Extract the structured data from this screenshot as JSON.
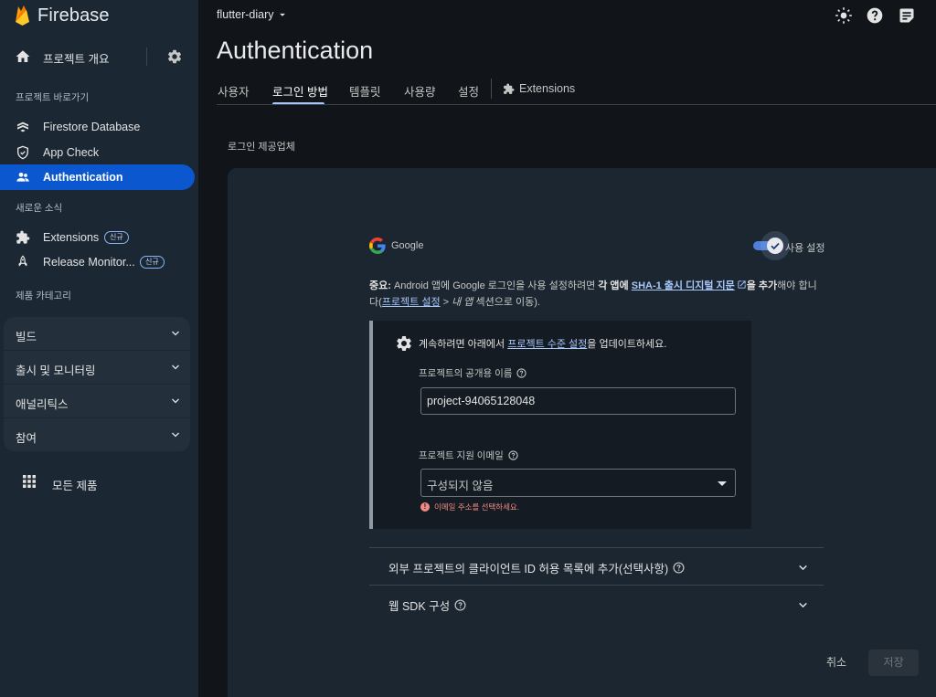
{
  "brand": {
    "name": "Firebase"
  },
  "sidebar": {
    "overview_label": "프로젝트 개요",
    "shortcuts_title": "프로젝트 바로가기",
    "shortcuts": [
      {
        "label": "Firestore Database",
        "icon": "firestore-icon"
      },
      {
        "label": "App Check",
        "icon": "shield-icon"
      },
      {
        "label": "Authentication",
        "icon": "people-icon",
        "active": true
      }
    ],
    "news_title": "새로운 소식",
    "news": [
      {
        "label": "Extensions",
        "badge": "신규",
        "icon": "puzzle-icon"
      },
      {
        "label": "Release Monitor...",
        "badge": "신규",
        "icon": "rocket-icon"
      }
    ],
    "categories_title": "제품 카테고리",
    "categories": [
      "빌드",
      "출시 및 모니터링",
      "애널리틱스",
      "참여"
    ],
    "all_products_label": "모든 제품"
  },
  "header": {
    "project_name": "flutter-diary",
    "title": "Authentication",
    "tabs": [
      "사용자",
      "로그인 방법",
      "템플릿",
      "사용량",
      "설정",
      "Extensions"
    ],
    "active_tab": "로그인 방법"
  },
  "main": {
    "section_label": "로그인 제공업체",
    "provider": {
      "name": "Google",
      "enabled": true,
      "toggle_label": "사용 설정"
    },
    "notice": {
      "important": "중요:",
      "text1": " Android 앱에 Google 로그인을 사용 설정하려면 ",
      "each_app": "각 앱에",
      "sha_link": "SHA-1 출시 디지털 지문",
      "add": "을 추가",
      "text2": "해야 합니다(",
      "settings_link": "프로젝트 설정",
      "text3": " > ",
      "my_apps": "내 앱",
      "text4": " 섹션으로 이동)."
    },
    "panel": {
      "msg_pre": "계속하려면 아래에서 ",
      "msg_link": "프로젝트 수준 설정",
      "msg_post": "을 업데이트하세요.",
      "public_name_label": "프로젝트의 공개용 이름",
      "public_name_value": "project-94065128048",
      "support_email_label": "프로젝트 지원 이메일",
      "support_email_value": "구성되지 않음",
      "error": "이메일 주소를 선택하세요."
    },
    "accordions": [
      "외부 프로젝트의 클라이언트 ID 허용 목록에 추가(선택사항)",
      "웹 SDK 구성"
    ],
    "cancel_label": "취소",
    "save_label": "저장"
  }
}
